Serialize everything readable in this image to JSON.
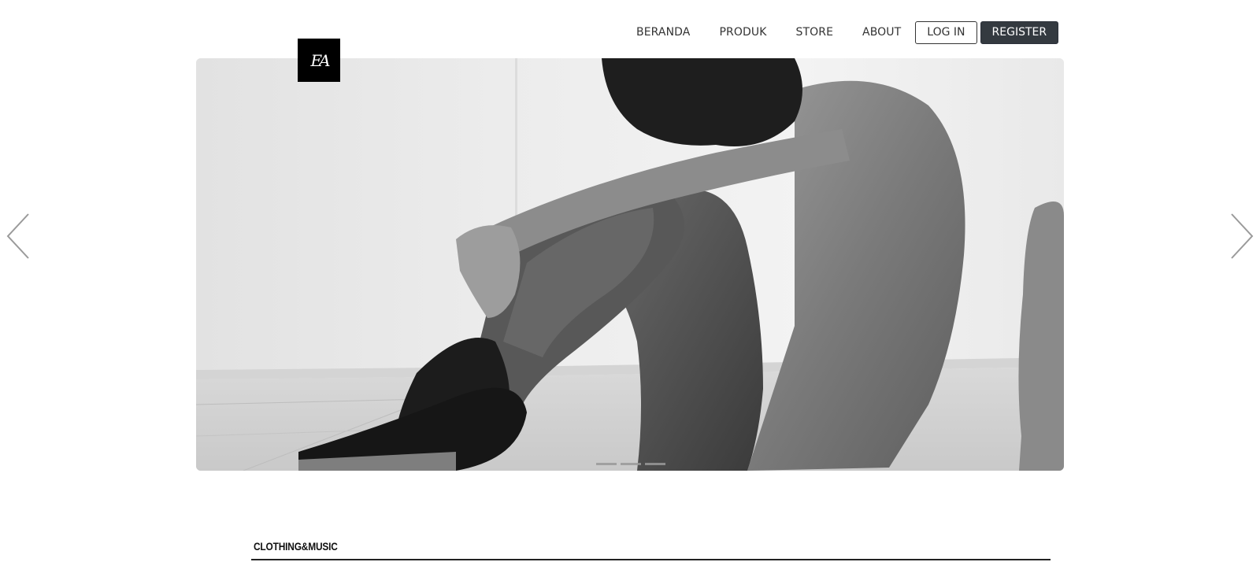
{
  "nav": {
    "items": [
      "BERANDA",
      "PRODUK",
      "STORE",
      "ABOUT"
    ],
    "login_label": "LOG IN",
    "register_label": "REGISTER"
  },
  "logo": {
    "text": "EA"
  },
  "carousel": {
    "slide_count": 3,
    "active_index": 0,
    "prev_icon": "chevron-left-icon",
    "next_icon": "chevron-right-icon"
  },
  "section": {
    "title": "CLOTHING&MUSIC"
  },
  "colors": {
    "register_bg": "#343a40",
    "text": "#333333",
    "photo_bg": "#e6e6e6"
  }
}
